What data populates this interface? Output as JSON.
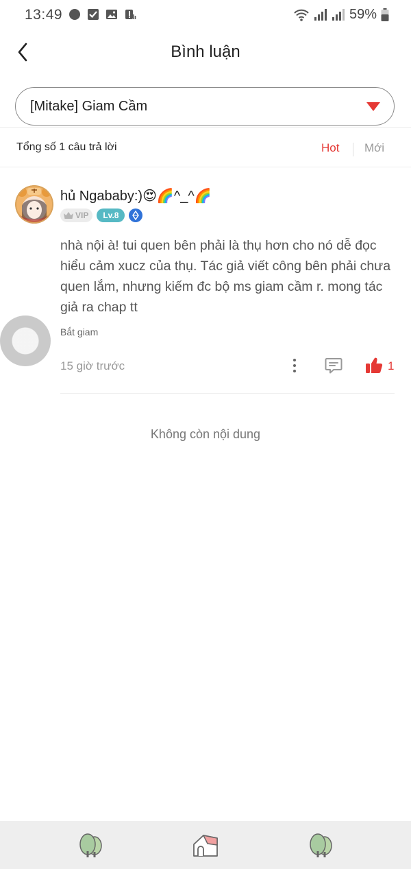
{
  "status_bar": {
    "time": "13:49",
    "battery": "59%"
  },
  "header": {
    "title": "Bình luận"
  },
  "selector": {
    "value": "[Mitake] Giam Cầm"
  },
  "summary": {
    "count_text": "Tổng số 1 câu trả lời",
    "sort_hot": "Hot",
    "sort_new": "Mới"
  },
  "comment": {
    "username": "hủ Ngababy:)😍🌈^_^🌈",
    "vip_label": "VIP",
    "level_label": "Lv.8",
    "text": "nhà nội à! tui quen bên phải là thụ hơn cho nó dễ đọc hiểu cảm xucz của thụ. Tác giả viết công bên phải chưa quen lắm, nhưng kiếm đc bộ ms giam cầm r. mong tác giả ra chap tt",
    "tag": "Bắt giam",
    "time": "15 giờ trước",
    "like_count": "1"
  },
  "end_message": "Không còn nội dung",
  "icons": {
    "back": "back-arrow-icon",
    "dropdown": "caret-down-icon",
    "more": "more-vertical-icon",
    "reply": "comment-icon",
    "like": "thumbs-up-icon",
    "nav": [
      "tree-icon",
      "home-icon",
      "tree-icon"
    ]
  },
  "colors": {
    "accent": "#e53935",
    "level_badge": "#56b9c4",
    "diamond_badge": "#2f72d8",
    "nav_background": "#eeeeee"
  }
}
